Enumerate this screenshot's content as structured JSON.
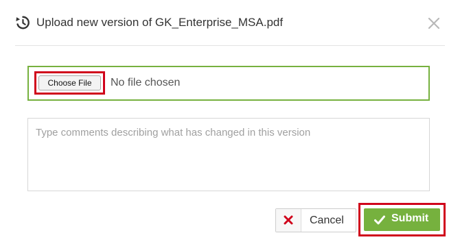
{
  "dialog": {
    "title": "Upload new version of GK_Enterprise_MSA.pdf",
    "header_icon": "history-icon",
    "close_icon": "close-icon"
  },
  "file_input": {
    "button_label": "Choose File",
    "status_text": "No file chosen",
    "border_color": "#76b13e"
  },
  "comments": {
    "value": "",
    "placeholder": "Type comments describing what has changed in this version"
  },
  "actions": {
    "cancel_label": "Cancel",
    "cancel_icon": "x-icon",
    "cancel_icon_color": "#d0021b",
    "submit_label": "Submit",
    "submit_icon": "checkmark-icon",
    "submit_color": "#76b13e"
  },
  "highlight_color": "#d0021b"
}
